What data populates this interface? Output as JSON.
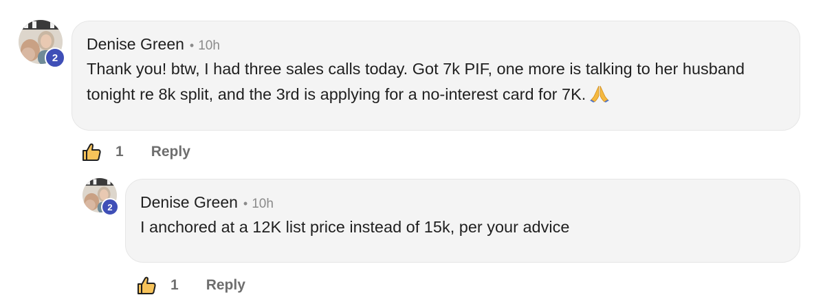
{
  "comment": {
    "author": "Denise Green",
    "time": "10h",
    "level": "2",
    "text": "Thank you! btw, I had three sales calls today. Got 7k PIF, one more is talking to her husband tonight re 8k split, and the 3rd is applying for a no-interest card for 7K.",
    "emoji": "folded-hands-emoji",
    "like_count": "1",
    "reply_label": "Reply"
  },
  "reply": {
    "author": "Denise Green",
    "time": "10h",
    "level": "2",
    "text": "I anchored at a 12K list price instead of 15k, per your advice",
    "like_count": "1",
    "reply_label": "Reply"
  },
  "icons": {
    "like": "thumbs-up-icon",
    "separator": "•"
  },
  "colors": {
    "badge": "#3f4fb7",
    "bubble": "#f4f4f4",
    "muted": "#8a8a8a"
  }
}
